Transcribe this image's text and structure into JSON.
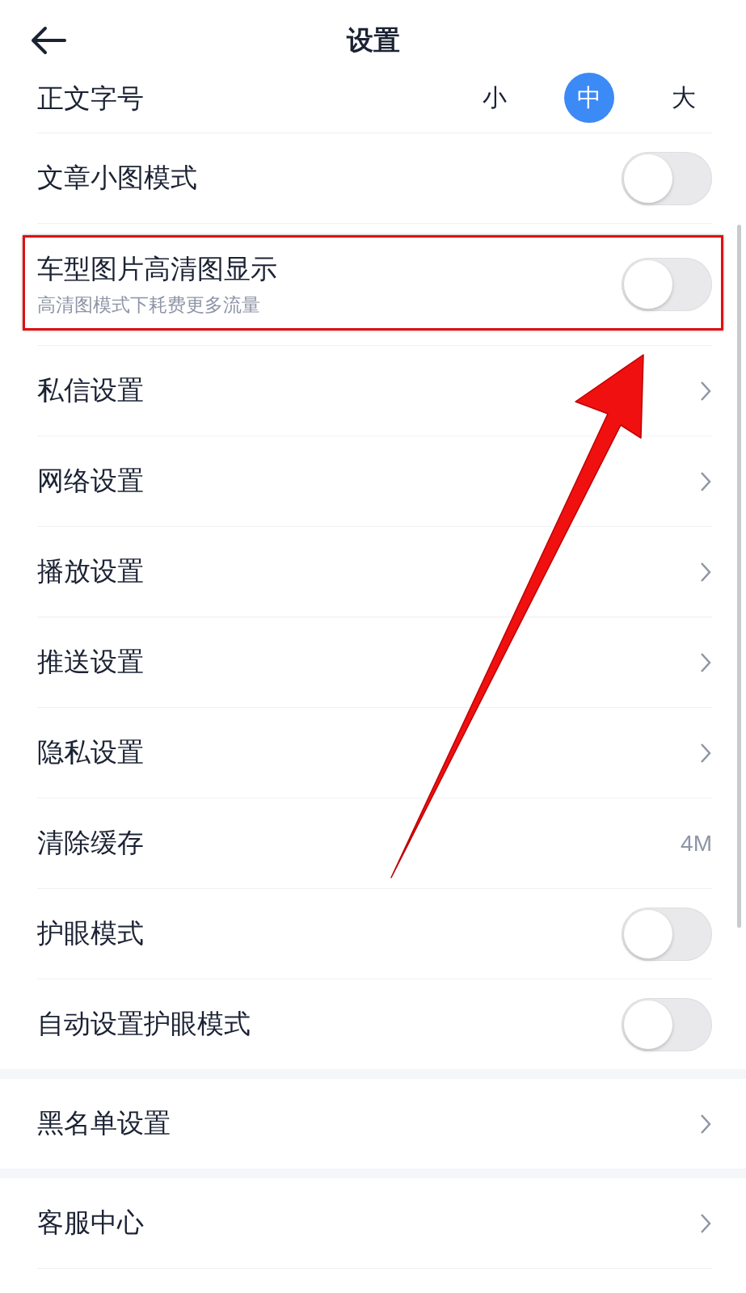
{
  "header": {
    "title": "设置"
  },
  "sections": [
    {
      "rows": [
        {
          "kind": "size-picker",
          "label": "正文字号",
          "options": [
            {
              "label": "小",
              "selected": false
            },
            {
              "label": "中",
              "selected": true
            },
            {
              "label": "大",
              "selected": false
            }
          ]
        },
        {
          "kind": "toggle",
          "label": "文章小图模式",
          "on": false
        },
        {
          "kind": "toggle",
          "label": "车型图片高清图显示",
          "subtitle": "高清图模式下耗费更多流量",
          "on": false,
          "highlighted": true
        },
        {
          "kind": "link",
          "label": "私信设置"
        },
        {
          "kind": "link",
          "label": "网络设置"
        },
        {
          "kind": "link",
          "label": "播放设置"
        },
        {
          "kind": "link",
          "label": "推送设置"
        },
        {
          "kind": "link",
          "label": "隐私设置"
        },
        {
          "kind": "value",
          "label": "清除缓存",
          "value": "4M"
        },
        {
          "kind": "toggle",
          "label": "护眼模式",
          "on": false
        },
        {
          "kind": "toggle",
          "label": "自动设置护眼模式",
          "on": false
        }
      ]
    },
    {
      "rows": [
        {
          "kind": "link",
          "label": "黑名单设置"
        }
      ]
    },
    {
      "rows": [
        {
          "kind": "link",
          "label": "客服中心"
        }
      ]
    }
  ]
}
